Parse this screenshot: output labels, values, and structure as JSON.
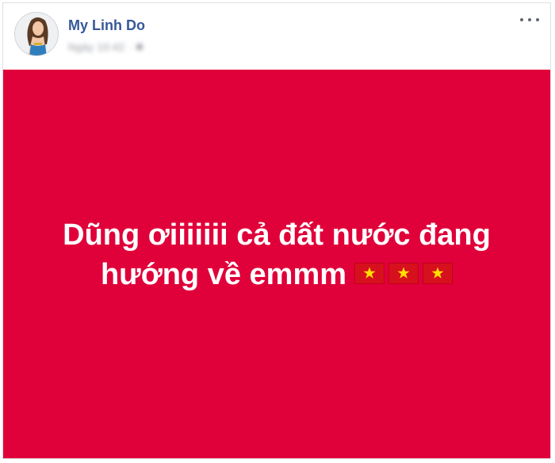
{
  "post": {
    "author": "My Linh Do",
    "timestamp": "Ngày 10:42 · ✱",
    "text_line1": "Dũng ơiiiiiii cả đất nước đang",
    "text_line2": "hướng về emmm",
    "background_color": "#e0003a",
    "flag_icons": [
      "vietnam-flag-icon",
      "vietnam-flag-icon",
      "vietnam-flag-icon"
    ]
  },
  "header": {
    "more_icon": "more-options-icon"
  }
}
